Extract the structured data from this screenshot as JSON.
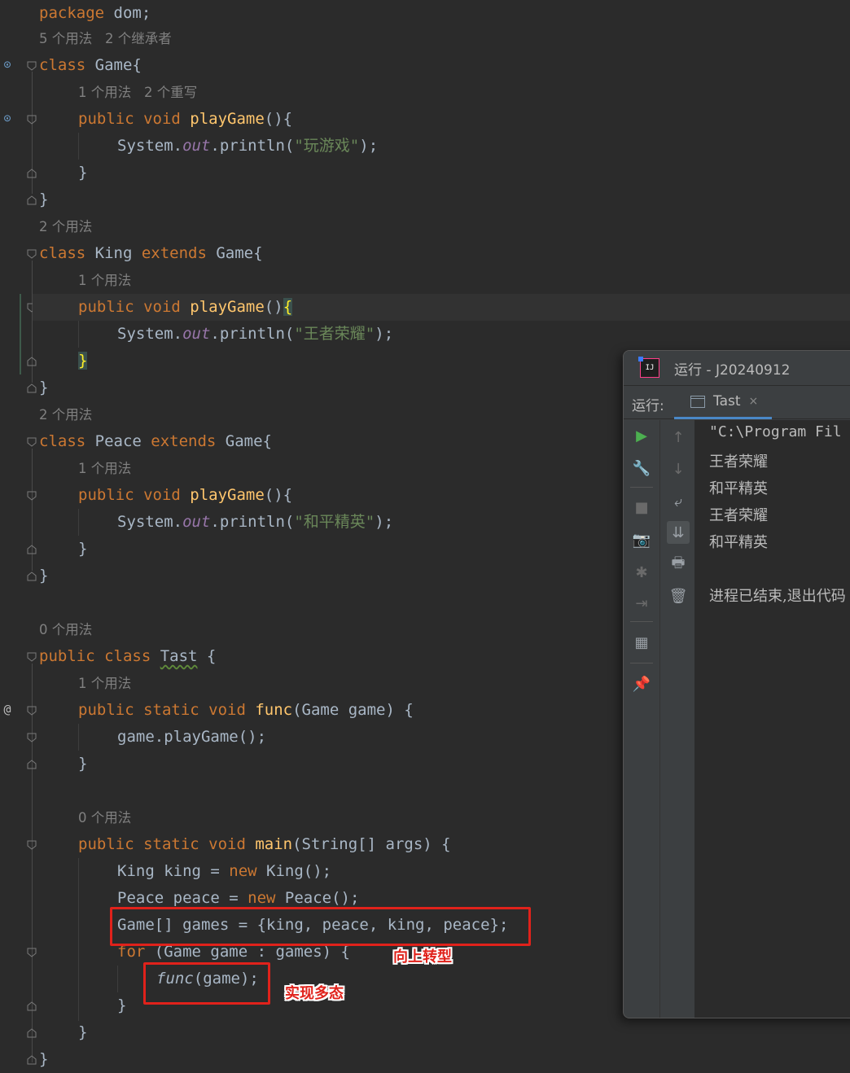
{
  "editor": {
    "package_kw": "package",
    "package_name": " dom;",
    "hint_game_usages": "5 个用法   2 个继承者",
    "class_kw": "class",
    "game_class": " Game{",
    "hint_playgame_game": "1 个用法   2 个重写",
    "public_void": "public void ",
    "playGame": "playGame",
    "parens_open": "(){",
    "parens": "()",
    "brace_open": "{",
    "system_out": "System.",
    "out": "out",
    "println": ".println(",
    "str_game": "\"玩游戏\"",
    "str_king": "\"王者荣耀\"",
    "str_peace": "\"和平精英\"",
    "close_paren_semi": ");",
    "close_brace": "}",
    "hint_2_usages": "2 个用法",
    "king_extends": " King ",
    "extends_kw": "extends",
    "game_brace": " Game{",
    "hint_1_usage": "1 个用法",
    "peace_extends": " Peace ",
    "hint_0_usages": "0 个用法",
    "public_class": "public class ",
    "tast": "Tast",
    "brace_space": " {",
    "public_static_void": "public static void ",
    "func": "func",
    "func_params": "(Game game) {",
    "game_playgame": "game.playGame();",
    "main": "main",
    "main_params": "(String[] args) {",
    "king_decl": "King king = ",
    "new_kw": "new",
    "king_ctor": " King();",
    "peace_decl": "Peace peace = ",
    "peace_ctor": " Peace();",
    "games_decl": "Game[] games = {king, peace, king, peace};",
    "for_kw": "for",
    "for_rest": " (Game game : games) {",
    "func_call_name": "func",
    "func_call_args": "(game);"
  },
  "annotations": {
    "upcast": "向上转型",
    "polymorphism": "实现多态"
  },
  "run_panel": {
    "title": "运行 - J20240912",
    "run_label": "运行:",
    "tab_name": "Tast",
    "tab_close": "×",
    "console": [
      "\"C:\\Program Fil",
      "王者荣耀",
      "和平精英",
      "王者荣耀",
      "和平精英",
      "",
      "进程已结束,退出代码"
    ]
  },
  "colors": {
    "background": "#2b2b2b",
    "keyword": "#cc7832",
    "function": "#ffc66d",
    "field": "#9876aa",
    "string": "#6a8759",
    "highlight_box": "#e0221b"
  },
  "icons": [
    "run-icon",
    "wrench-icon",
    "stop-icon",
    "camera-icon",
    "debug-icon",
    "login-icon",
    "layout-icon",
    "pin-icon",
    "up-arrow-icon",
    "down-arrow-icon",
    "wrap-icon",
    "scroll-end-icon",
    "print-icon",
    "trash-icon",
    "fold-icon",
    "override-icon",
    "implemented-icon"
  ]
}
